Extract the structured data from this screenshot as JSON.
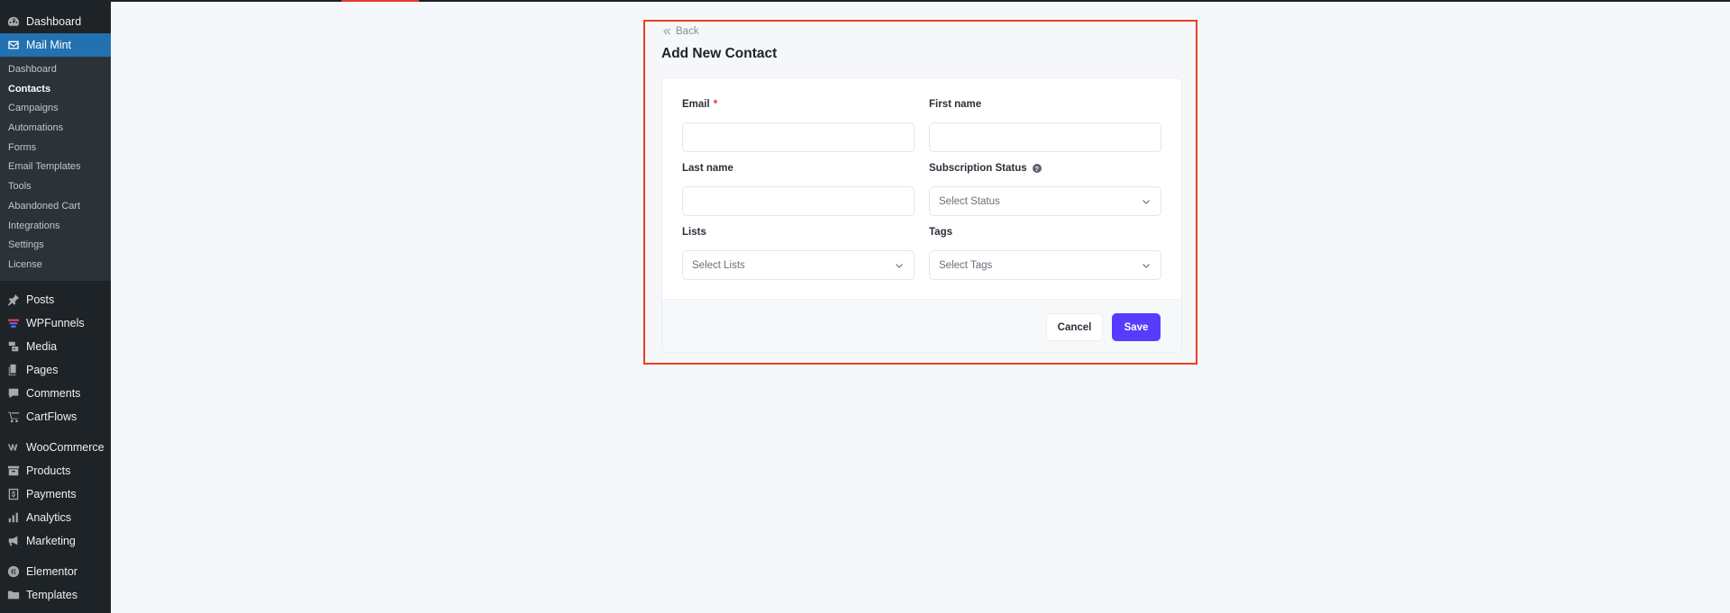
{
  "sidebar": {
    "top_items": [
      {
        "label": "Dashboard",
        "icon": "dashboard-icon"
      },
      {
        "label": "Mail Mint",
        "icon": "mail-icon"
      }
    ],
    "submenu": [
      {
        "label": "Dashboard"
      },
      {
        "label": "Contacts"
      },
      {
        "label": "Campaigns"
      },
      {
        "label": "Automations"
      },
      {
        "label": "Forms"
      },
      {
        "label": "Email Templates"
      },
      {
        "label": "Tools"
      },
      {
        "label": "Abandoned Cart"
      },
      {
        "label": "Integrations"
      },
      {
        "label": "Settings"
      },
      {
        "label": "License"
      }
    ],
    "group1": [
      {
        "label": "Posts",
        "icon": "pin-icon"
      },
      {
        "label": "WPFunnels",
        "icon": "funnel-icon"
      },
      {
        "label": "Media",
        "icon": "media-icon"
      },
      {
        "label": "Pages",
        "icon": "pages-icon"
      },
      {
        "label": "Comments",
        "icon": "comment-icon"
      },
      {
        "label": "CartFlows",
        "icon": "cart-icon"
      }
    ],
    "group2": [
      {
        "label": "WooCommerce",
        "icon": "woo-icon"
      },
      {
        "label": "Products",
        "icon": "archive-icon"
      },
      {
        "label": "Payments",
        "icon": "payment-icon"
      },
      {
        "label": "Analytics",
        "icon": "bar-chart-icon"
      },
      {
        "label": "Marketing",
        "icon": "megaphone-icon"
      }
    ],
    "group3": [
      {
        "label": "Elementor",
        "icon": "elementor-icon"
      },
      {
        "label": "Templates",
        "icon": "folder-icon"
      }
    ]
  },
  "page": {
    "back_label": "Back",
    "title": "Add New Contact"
  },
  "form": {
    "email": {
      "label": "Email",
      "required_mark": "*"
    },
    "first_name": {
      "label": "First name"
    },
    "last_name": {
      "label": "Last name"
    },
    "subscription_status": {
      "label": "Subscription Status",
      "help": "?",
      "placeholder": "Select Status"
    },
    "lists": {
      "label": "Lists",
      "placeholder": "Select Lists"
    },
    "tags": {
      "label": "Tags",
      "placeholder": "Select Tags"
    }
  },
  "actions": {
    "cancel": "Cancel",
    "save": "Save"
  },
  "colors": {
    "primary": "#573bff",
    "highlight_border": "#e5411f",
    "sidebar_bg": "#1d2327",
    "sidebar_current": "#2271b1"
  }
}
